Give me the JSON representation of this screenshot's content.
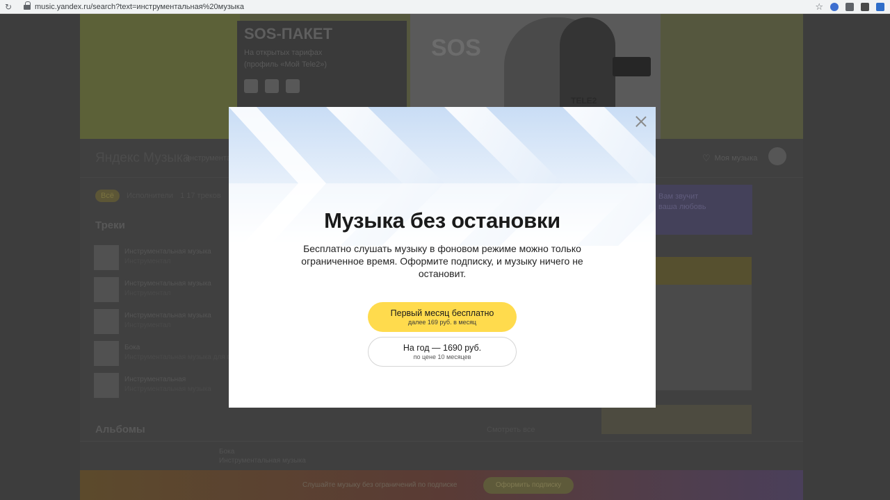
{
  "browser": {
    "url": "music.yandex.ru/search?text=инструментальная%20музыка"
  },
  "ad_banner": {
    "title": "SOS-ПАКЕТ",
    "line1": "На открытых тарифах",
    "line2": "(профиль «Мой Tele2»)",
    "bubble": "SOS",
    "brand": "TELE2"
  },
  "header": {
    "logo": "Яндекс Музыка",
    "search_value": "инструментальная музыка",
    "my_music": "Моя музыка"
  },
  "filters": {
    "active": "Всё",
    "items": [
      "Исполнители",
      "1 17 треков"
    ]
  },
  "tracks": {
    "title": "Треки",
    "items": [
      {
        "title": "Инструментальная музыка",
        "artist": "Инструментал"
      },
      {
        "title": "Инструментальная музыка",
        "artist": "Инструментал"
      },
      {
        "title": "Инструментальная музыка",
        "artist": "Инструментал"
      },
      {
        "title": "Бока",
        "artist": "Инструментальная музыка для вас"
      },
      {
        "title": "Инструментальная",
        "artist": "Инструментальная музыка"
      }
    ]
  },
  "albums": {
    "title": "Альбомы",
    "see_all": "Смотреть все"
  },
  "side": {
    "card_line1": "Вам звучит",
    "card_line2": "ваша любовь"
  },
  "player": {
    "track": "Бока",
    "artist": "Инструментальная музыка"
  },
  "paybar": {
    "text": "Слушайте музыку без ограничений по подписке",
    "button": "Оформить подписку"
  },
  "modal": {
    "title": "Музыка без остановки",
    "description": "Бесплатно слушать музыку в фоновом режиме можно только ограниченное время. Оформите подписку, и музыку ничего не остановит.",
    "primary_label": "Первый месяц бесплатно",
    "primary_sub": "далее 169 руб. в месяц",
    "secondary_label": "На год — 1690 руб.",
    "secondary_sub": "по цене 10 месяцев",
    "close_icon": "close-icon"
  },
  "colors": {
    "accent": "#ffdb4d",
    "overlay": "#3d3d3d"
  }
}
